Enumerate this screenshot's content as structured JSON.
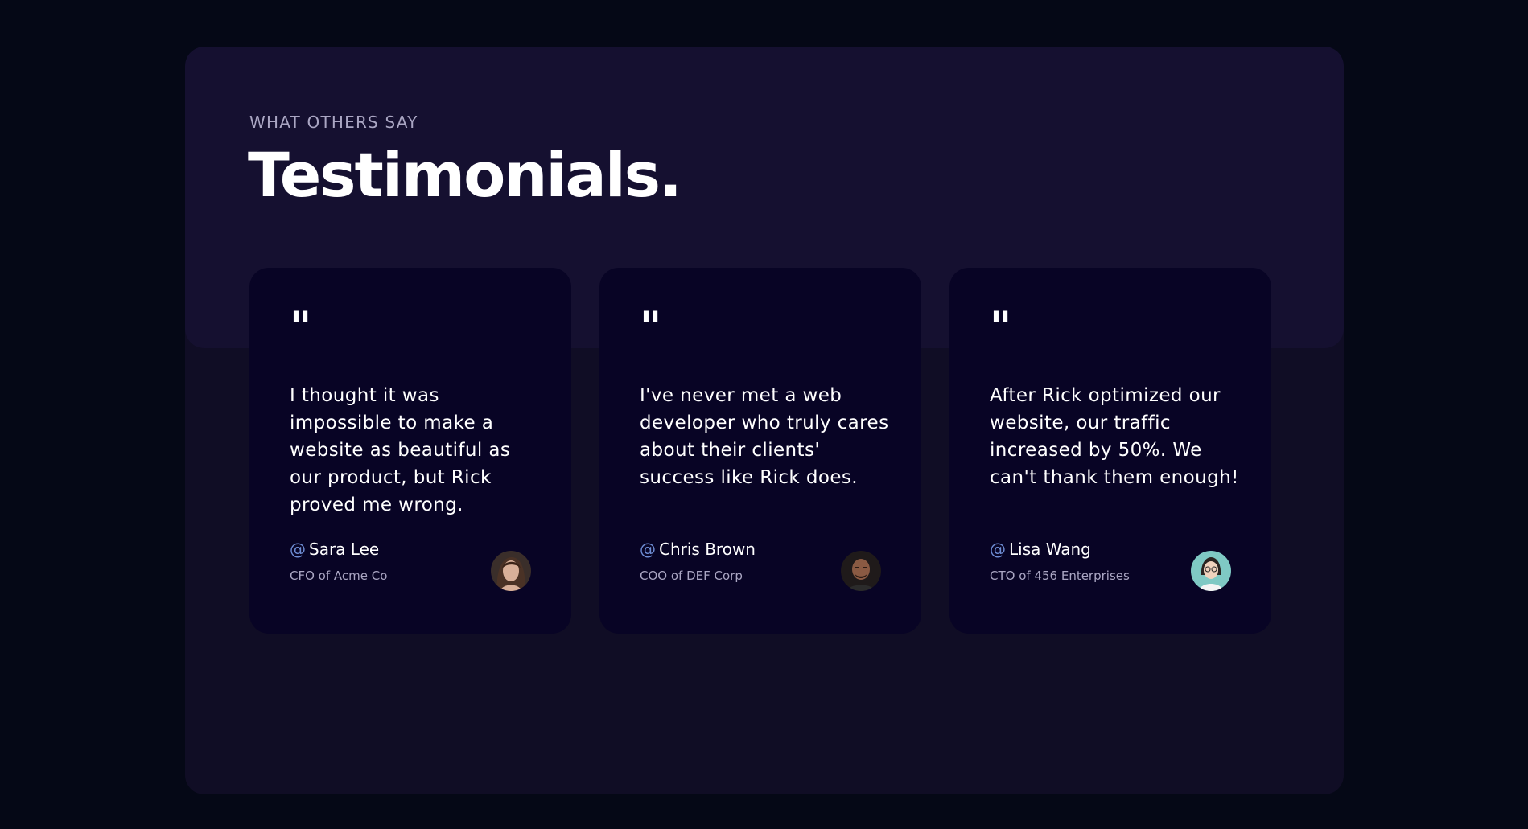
{
  "section": {
    "subtitle": "What others say",
    "title": "Testimonials."
  },
  "testimonials": [
    {
      "quote_mark": "\"",
      "text": "I thought it was impossible to make a website as beautiful as our product, but Rick proved me wrong.",
      "at": "@",
      "name": "Sara Lee",
      "role": "CFO of Acme Co",
      "avatar_icon": "woman-portrait-avatar"
    },
    {
      "quote_mark": "\"",
      "text": "I've never met a web developer who truly cares about their clients' success like Rick does.",
      "at": "@",
      "name": "Chris Brown",
      "role": "COO of DEF Corp",
      "avatar_icon": "man-portrait-avatar"
    },
    {
      "quote_mark": "\"",
      "text": "After Rick optimized our website, our traffic increased by 50%. We can't thank them enough!",
      "at": "@",
      "name": "Lisa Wang",
      "role": "CTO of 456 Enterprises",
      "avatar_icon": "woman-glasses-portrait-avatar"
    }
  ],
  "colors": {
    "background": "#050816",
    "outer_panel": "#100d25",
    "header_panel": "#151030",
    "card": "#080425",
    "secondary_text": "#aaa6c3",
    "accent_at": "#6f8ed6",
    "white": "#ffffff"
  }
}
